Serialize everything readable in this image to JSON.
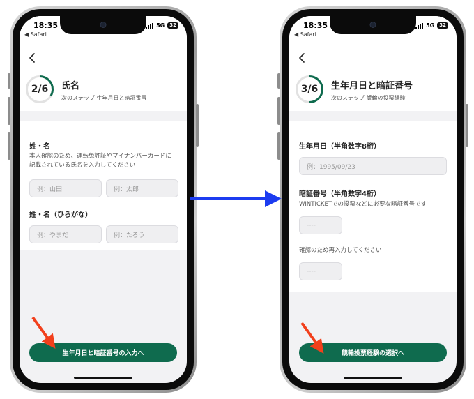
{
  "status_bar": {
    "time": "18:35",
    "back_app": "◀ Safari",
    "network": "5G",
    "battery": "32"
  },
  "left_screen": {
    "step": "2/6",
    "title": "氏名",
    "next_step": "次のステップ 生年月日と暗証番号",
    "name_label": "姓・名",
    "name_description": "本人確認のため、運転免許証やマイナンバーカードに記載されている氏名を入力してください",
    "last_name_placeholder": "例：山田",
    "first_name_placeholder": "例：太郎",
    "kana_label": "姓・名（ひらがな）",
    "last_kana_placeholder": "例：やまだ",
    "first_kana_placeholder": "例：たろう",
    "button_label": "生年月日と暗証番号の入力へ",
    "progress": 0.333
  },
  "right_screen": {
    "step": "3/6",
    "title": "生年月日と暗証番号",
    "next_step": "次のステップ 競輪の投票経験",
    "birthdate_label": "生年月日（半角数字8桁）",
    "birthdate_placeholder": "例：1995/09/23",
    "pin_label": "暗証番号（半角数字4桁）",
    "pin_description": "WINTICKETでの投票などに必要な暗証番号です",
    "pin_placeholder": "----",
    "confirm_description": "確認のため再入力してください",
    "confirm_placeholder": "----",
    "button_label": "競輪投票経験の選択へ",
    "progress": 0.5
  },
  "colors": {
    "accent": "#0f6b4e",
    "flow_arrow": "#1c3cf0",
    "pointer_arrow": "#f2401c"
  }
}
